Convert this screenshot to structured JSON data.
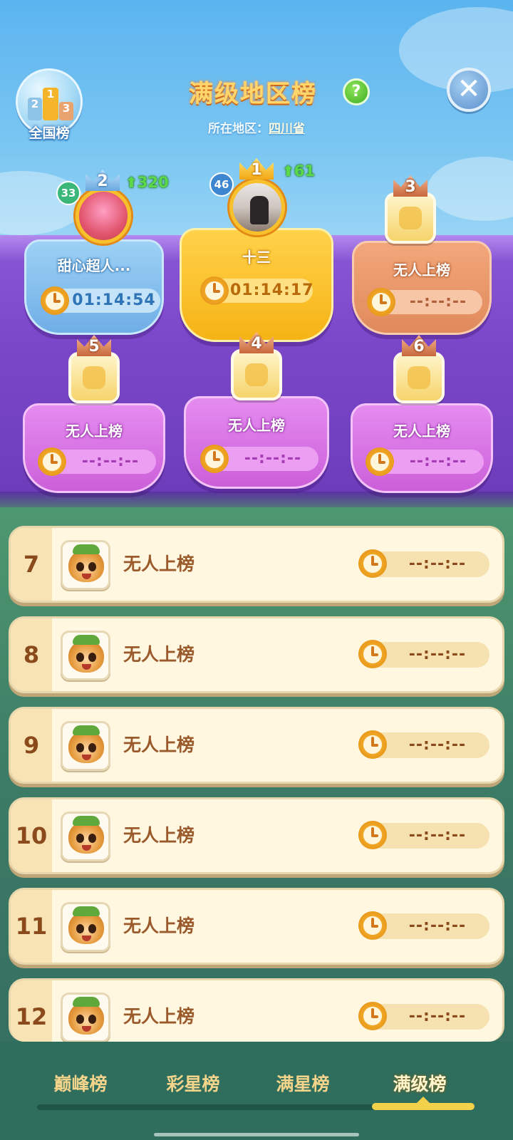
{
  "header": {
    "national_label": "全国榜",
    "national_icon_digits": [
      "2",
      "1",
      "3"
    ],
    "title": "满级地区榜",
    "help_glyph": "?",
    "close_glyph": "✕",
    "region_label": "所在地区：",
    "region_value": "四川省"
  },
  "podium": {
    "first": {
      "rank": "1",
      "level": "46",
      "gain": "61",
      "name": "十三",
      "time": "01:14:17"
    },
    "second": {
      "rank": "2",
      "level": "33",
      "gain": "320",
      "name": "甜心超人...",
      "time": "01:14:54"
    },
    "third": {
      "rank": "3",
      "name": "无人上榜",
      "time": "--:--:--"
    },
    "fourth": {
      "rank": "4",
      "name": "无人上榜",
      "time": "--:--:--"
    },
    "fifth": {
      "rank": "5",
      "name": "无人上榜",
      "time": "--:--:--"
    },
    "sixth": {
      "rank": "6",
      "name": "无人上榜",
      "time": "--:--:--"
    }
  },
  "list": [
    {
      "rank": "7",
      "name": "无人上榜",
      "time": "--:--:--"
    },
    {
      "rank": "8",
      "name": "无人上榜",
      "time": "--:--:--"
    },
    {
      "rank": "9",
      "name": "无人上榜",
      "time": "--:--:--"
    },
    {
      "rank": "10",
      "name": "无人上榜",
      "time": "--:--:--"
    },
    {
      "rank": "11",
      "name": "无人上榜",
      "time": "--:--:--"
    },
    {
      "rank": "12",
      "name": "无人上榜",
      "time": "--:--:--"
    }
  ],
  "tabs": [
    {
      "label": "巅峰榜",
      "active": false
    },
    {
      "label": "彩星榜",
      "active": false
    },
    {
      "label": "满星榜",
      "active": false
    },
    {
      "label": "满级榜",
      "active": true
    }
  ],
  "colors": {
    "title_gold": "#ffd66b",
    "gain_green": "#5bd94a",
    "row_bg": "#fff7e0",
    "rank_brown": "#8a4a1c",
    "tab_active_indicator": "#f1d24a"
  }
}
